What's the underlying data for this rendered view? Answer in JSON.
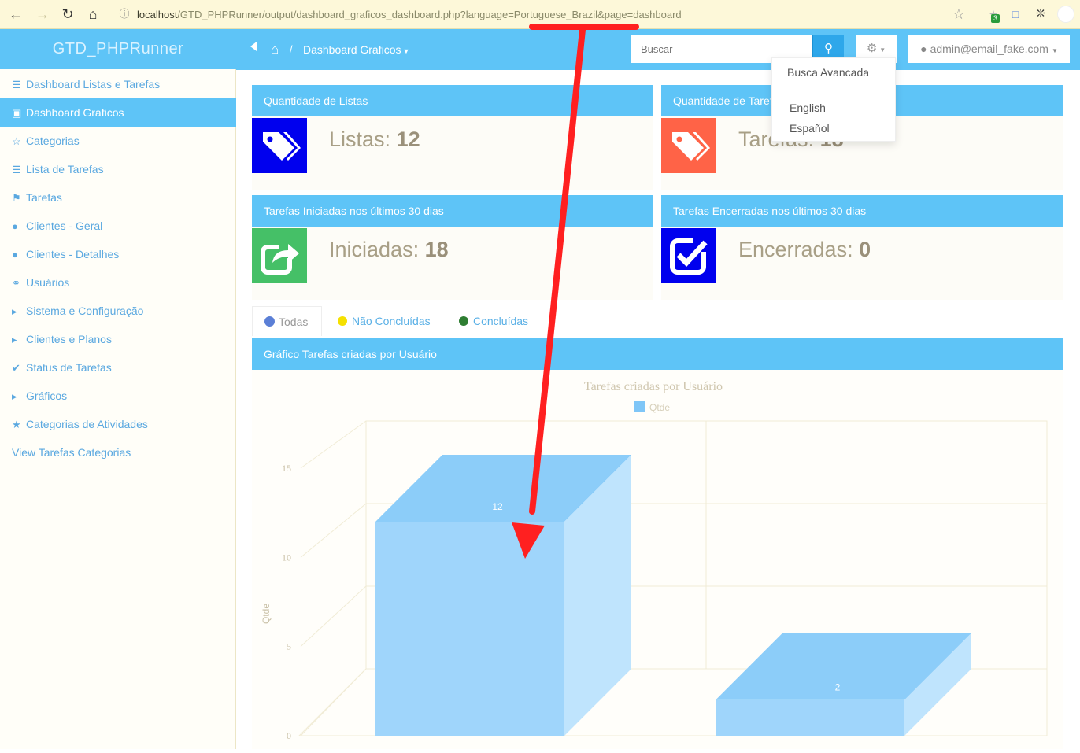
{
  "browser": {
    "url_host": "localhost",
    "url_path": "/GTD_PHPRunner/output/dashboard_graficos_dashboard.php?language=Portuguese_Brazil&page=dashboard",
    "extension_badge": "3"
  },
  "sidebar": {
    "brand": "GTD_PHPRunner",
    "items": [
      {
        "label": "Dashboard Listas e Tarefas",
        "icon": "list-icon"
      },
      {
        "label": "Dashboard Graficos",
        "icon": "dashboard-icon"
      },
      {
        "label": "Categorias",
        "icon": "star-outline-icon"
      },
      {
        "label": "Lista de Tarefas",
        "icon": "list-icon"
      },
      {
        "label": "Tarefas",
        "icon": "tags-icon"
      },
      {
        "label": "Clientes - Geral",
        "icon": "user-icon"
      },
      {
        "label": "Clientes - Detalhes",
        "icon": "user-icon"
      },
      {
        "label": "Usuários",
        "icon": "glasses-icon"
      },
      {
        "label": "Sistema e Configuração",
        "icon": "caret-right-icon"
      },
      {
        "label": "Clientes e Planos",
        "icon": "caret-right-icon"
      },
      {
        "label": "Status de Tarefas",
        "icon": "check-icon"
      },
      {
        "label": "Gráficos",
        "icon": "caret-right-icon"
      },
      {
        "label": "Categorias de Atividades",
        "icon": "star-icon"
      },
      {
        "label": "View Tarefas Categorias",
        "icon": ""
      }
    ]
  },
  "topnav": {
    "breadcrumb_separator": "/",
    "breadcrumb_current": "Dashboard Graficos",
    "search_placeholder": "Buscar",
    "user": "admin@email_fake.com"
  },
  "dropdown": {
    "items": [
      "Busca Avancada",
      "English",
      "Español"
    ]
  },
  "panels": [
    {
      "title": "Quantidade de Listas",
      "label": "Listas:",
      "value": "12",
      "icon_color": "#0000ee",
      "icon": "tags-icon"
    },
    {
      "title": "Quantidade de Tarefas",
      "label": "Tarefas:",
      "value": "18",
      "icon_color": "#ff6347",
      "icon": "tags-icon"
    },
    {
      "title": "Tarefas Iniciadas nos últimos 30 dias",
      "label": "Iniciadas:",
      "value": "18",
      "icon_color": "#45c067",
      "icon": "share-icon"
    },
    {
      "title": "Tarefas Encerradas nos últimos 30 dias",
      "label": "Encerradas:",
      "value": "0",
      "icon_color": "#0000ee",
      "icon": "checkbox-icon"
    }
  ],
  "tabs": [
    {
      "label": "Todas",
      "color": "#5b7fd6"
    },
    {
      "label": "Não Concluídas",
      "color": "#f5e000"
    },
    {
      "label": "Concluídas",
      "color": "#2e7d32"
    }
  ],
  "chart_section_title": "Gráfico Tarefas criadas por Usuário",
  "chart_data": {
    "type": "bar",
    "title": "Tarefas criadas por Usuário",
    "ylabel": "Qtde",
    "legend": [
      {
        "name": "Qtde",
        "color": "#7fc6f7"
      }
    ],
    "categories": [
      "",
      ""
    ],
    "series": [
      {
        "name": "Qtde",
        "values": [
          12,
          2
        ]
      }
    ],
    "data_labels": [
      "12",
      "2"
    ],
    "ylim": [
      0,
      15
    ],
    "yticks": [
      "0",
      "5",
      "10",
      "15"
    ],
    "grid": true,
    "three_d": true
  }
}
